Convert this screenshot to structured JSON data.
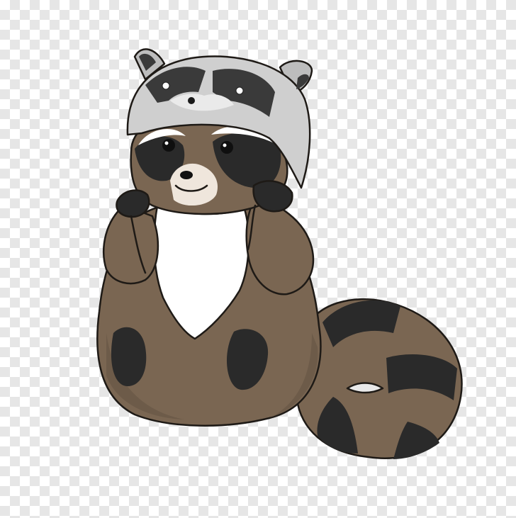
{
  "image": {
    "background": "transparency-checkerboard",
    "subject": "raccoon-wearing-raccoon-hat",
    "colors": {
      "fur": "#7a6652",
      "fur_dark": "#5e4d3d",
      "mask": "#2a2a2a",
      "chest": "#ffffff",
      "hat": "#bdbdbd",
      "hat_dark": "#3a3a3a",
      "outline": "#1e1a16"
    }
  }
}
